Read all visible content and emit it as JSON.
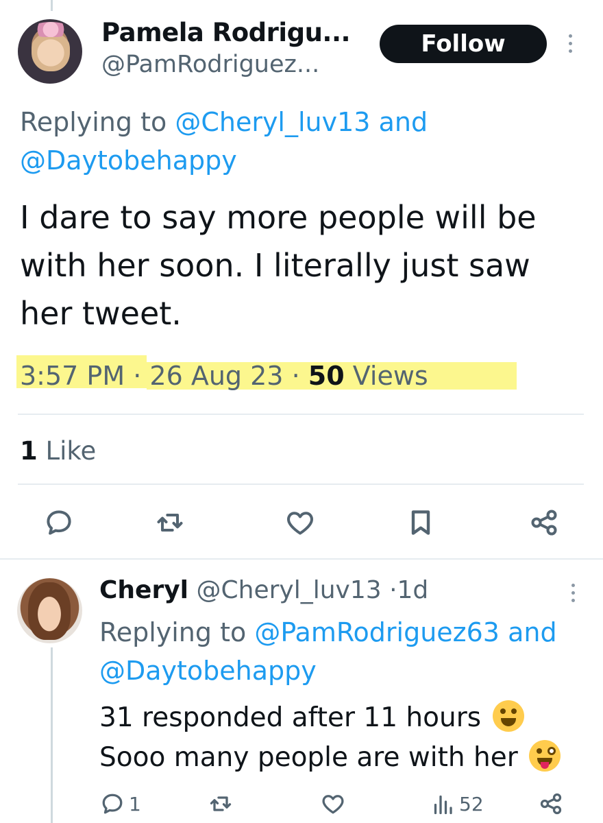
{
  "main_tweet": {
    "author_name": "Pamela Rodrigu...",
    "author_handle": "@PamRodriguez...",
    "follow_label": "Follow",
    "replying_prefix": "Replying to",
    "replying_mention_1": "@Cheryl_luv13",
    "replying_and": "and",
    "replying_mention_2": "@Daytobehappy",
    "text": "I dare to say more people will be with her soon. I literally just saw her tweet.",
    "time": "3:57 PM",
    "separator": "·",
    "date": "26 Aug 23",
    "views_count": "50",
    "views_label": "Views",
    "likes_count": "1",
    "likes_label": "Like",
    "highlight_color": "#fbf67a",
    "actions": [
      "reply-icon",
      "retweet-icon",
      "like-icon",
      "bookmark-icon",
      "share-icon"
    ]
  },
  "reply_tweet": {
    "author_name": "Cheryl",
    "author_handle": "@Cheryl_luv13",
    "separator": "·",
    "age": "1d",
    "replying_prefix": "Replying to",
    "replying_mention_1": "@PamRodriguez63",
    "replying_and": "and",
    "replying_mention_2": "@Daytobehappy",
    "text_line_1": "31 responded after 11 hours",
    "text_line_2": "Sooo many people are with her",
    "reply_count": "1",
    "views_count": "52",
    "emojis": [
      "rofl-emoji",
      "winking-tongue-emoji"
    ]
  },
  "colors": {
    "accent": "#1d9bf0",
    "text": "#0f1419",
    "secondary_text": "#536471",
    "divider": "#e6ecf0"
  }
}
